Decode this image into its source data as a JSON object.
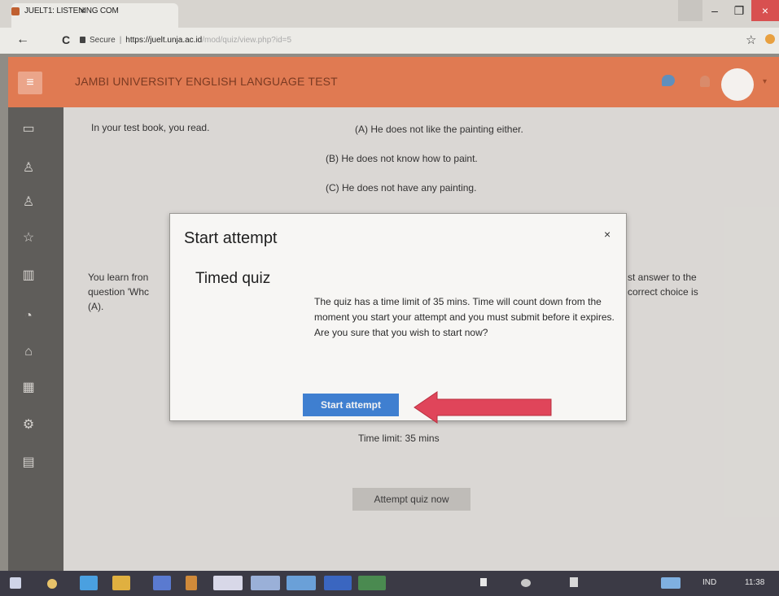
{
  "browser": {
    "tab_title": "JUELT1: LISTENING COM",
    "tab_close": "×",
    "window_controls": [
      "–",
      "❐",
      "×"
    ],
    "nav": {
      "back": "←",
      "reload": "C"
    },
    "url_secure": "Secure",
    "url_separator": "|",
    "url_text": "https://juelt.unja.ac.id",
    "url_path": "/mod/quiz/view.php?id=5",
    "star": "☆"
  },
  "header": {
    "menu_icon": "≡",
    "site_title": "JAMBI UNIVERSITY ENGLISH LANGUAGE TEST",
    "avatar_caret": "▾"
  },
  "sidebar_icons": [
    "folder-icon",
    "user-search-icon",
    "user-icon",
    "star-icon",
    "book-icon",
    "gauge-icon",
    "home-icon",
    "calendar-icon",
    "settings-icon",
    "library-icon"
  ],
  "question": {
    "intro": "In your test book, you read.",
    "option_a": "(A) He does not like the painting either.",
    "option_b": "(B) He does not know how to paint.",
    "option_c": "(C) He does not have any painting.",
    "learn_left_1": "You learn fron",
    "learn_left_2": "question 'Whc",
    "learn_left_3": "(A).",
    "learn_right_1": "st answer to the",
    "learn_right_2": "correct choice is"
  },
  "page": {
    "time_limit": "Time limit: 35 mins",
    "attempt_button": "Attempt quiz now"
  },
  "modal": {
    "title": "Start attempt",
    "close": "×",
    "subtitle": "Timed quiz",
    "body": "The quiz has a time limit of 35 mins. Time will count down from the moment you start your attempt and you must submit before it expires. Are you sure that you wish to start now?",
    "start_button": "Start attempt"
  },
  "taskbar": {
    "lang": "IND",
    "clock": "11:38"
  },
  "colors": {
    "header": "#e07a52",
    "sidebar": "#5f5d5a",
    "primary_button": "#3f7fd0",
    "arrow": "#e0455a"
  }
}
